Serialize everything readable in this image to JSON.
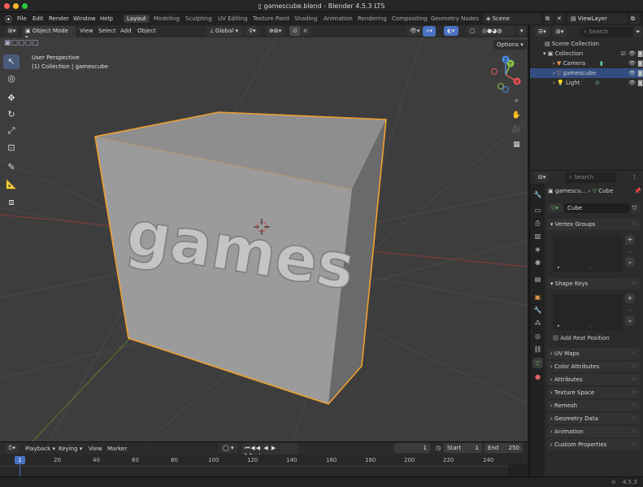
{
  "window": {
    "title": "gamescube.blend - Blender 4.5.3 LTS"
  },
  "menubar": {
    "items": [
      "File",
      "Edit",
      "Render",
      "Window",
      "Help"
    ]
  },
  "workspaces": {
    "tabs": [
      "Layout",
      "Modeling",
      "Sculpting",
      "UV Editing",
      "Texture Paint",
      "Shading",
      "Animation",
      "Rendering",
      "Compositing",
      "Geometry Nodes"
    ],
    "active": "Layout"
  },
  "scene": {
    "name": "Scene"
  },
  "viewlayer": {
    "name": "ViewLayer"
  },
  "viewport_header": {
    "mode": "Object Mode",
    "menus": [
      "View",
      "Select",
      "Add",
      "Object"
    ],
    "transform_orientation": "Global",
    "options_label": "Options"
  },
  "viewport": {
    "view_name": "User Perspective",
    "context": "(1) Collection | gamescube",
    "cube_text": "games",
    "gizmo_axes": [
      "X",
      "Y",
      "Z"
    ]
  },
  "outliner": {
    "search_placeholder": "Search",
    "rows": [
      {
        "label": "Scene Collection"
      },
      {
        "label": "Collection"
      },
      {
        "label": "Camera"
      },
      {
        "label": "gamescube"
      },
      {
        "label": "Light"
      }
    ]
  },
  "properties": {
    "search_placeholder": "Search",
    "breadcrumb_object": "gamescu...",
    "breadcrumb_data": "Cube",
    "mesh_name": "Cube",
    "panels": {
      "vertex_groups": "Vertex Groups",
      "shape_keys": "Shape Keys",
      "add_rest_position": "Add Rest Position",
      "uv_maps": "UV Maps",
      "color_attributes": "Color Attributes",
      "attributes": "Attributes",
      "texture_space": "Texture Space",
      "remesh": "Remesh",
      "geometry_data": "Geometry Data",
      "animation": "Animation",
      "custom_properties": "Custom Properties"
    }
  },
  "timeline": {
    "menus": [
      "Playback",
      "Keying",
      "View",
      "Marker"
    ],
    "current_frame": "1",
    "start_label": "Start",
    "start": "1",
    "end_label": "End",
    "end": "250",
    "playhead": "1",
    "ticks": [
      "20",
      "40",
      "60",
      "80",
      "100",
      "120",
      "140",
      "160",
      "180",
      "200",
      "220",
      "240"
    ]
  },
  "statusbar": {
    "version": "4.5.3"
  },
  "colors": {
    "selection_outline": "#f0a030",
    "active_row": "#334d80",
    "accent_blue": "#4a72c4"
  }
}
